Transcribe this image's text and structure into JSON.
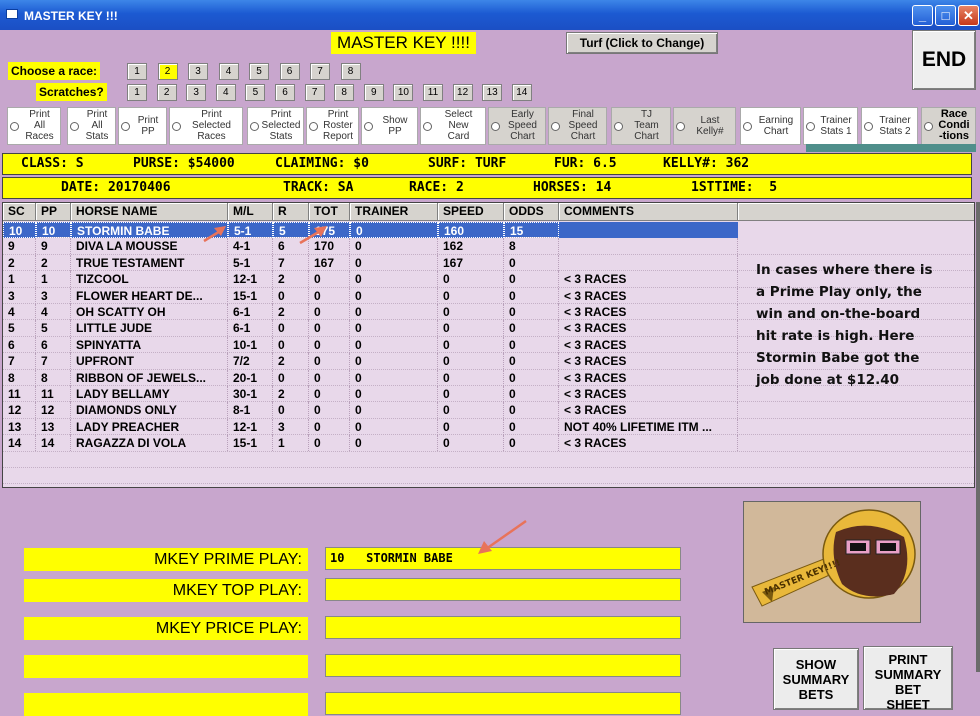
{
  "window": {
    "title": "MASTER KEY !!!"
  },
  "header": {
    "title": "MASTER KEY !!!!",
    "turf_button": "Turf (Click to Change)",
    "end_button": "END"
  },
  "race_chooser": {
    "label": "Choose  a race:",
    "numbers": [
      "1",
      "2",
      "3",
      "4",
      "5",
      "6",
      "7",
      "8"
    ],
    "selected": "2"
  },
  "scratches": {
    "label": "Scratches?",
    "numbers": [
      "1",
      "2",
      "3",
      "4",
      "5",
      "6",
      "7",
      "8",
      "9",
      "10",
      "11",
      "12",
      "13",
      "14"
    ]
  },
  "options": [
    {
      "label": "Print\nAll\nRaces",
      "style": "white"
    },
    {
      "label": "Print\nAll\nStats",
      "style": "white"
    },
    {
      "label": "Print\nPP",
      "style": "white"
    },
    {
      "label": "Print\nSelected\nRaces",
      "style": "white"
    },
    {
      "label": "Print\nSelected\nStats",
      "style": "white"
    },
    {
      "label": "Print\nRoster\nReport",
      "style": "white"
    },
    {
      "label": "Show\nPP",
      "style": "white"
    },
    {
      "label": "Select\nNew\nCard",
      "style": "white"
    },
    {
      "label": "Early\nSpeed\nChart",
      "style": "gray"
    },
    {
      "label": "Final\nSpeed\nChart",
      "style": "gray"
    },
    {
      "label": "TJ\nTeam\nChart",
      "style": "gray"
    },
    {
      "label": "Last\nKelly#",
      "style": "gray"
    },
    {
      "label": "Earning\nChart",
      "style": "white"
    },
    {
      "label": "Trainer\nStats 1",
      "style": "white"
    },
    {
      "label": "Trainer\nStats 2",
      "style": "white"
    },
    {
      "label": "Race\nCondi\n-tions",
      "style": "race"
    }
  ],
  "info1": {
    "class": "CLASS: S",
    "purse": "PURSE: $54000",
    "claiming": "CLAIMING: $0",
    "surf": "SURF: TURF",
    "fur": "FUR: 6.5",
    "kelly": "KELLY#: 362"
  },
  "info2": {
    "date": "DATE: 20170406",
    "track": "TRACK: SA",
    "race": "RACE: 2",
    "horses": "HORSES: 14",
    "first": "1STTIME:  5"
  },
  "table": {
    "columns": [
      "SC",
      "PP",
      "HORSE NAME",
      "M/L",
      "R",
      "TOT",
      "TRAINER",
      "SPEED",
      "ODDS",
      "COMMENTS"
    ],
    "rows": [
      [
        "10",
        "10",
        "STORMIN BABE",
        "5-1",
        "5",
        "175",
        "0",
        "160",
        "15",
        ""
      ],
      [
        "9",
        "9",
        "DIVA LA MOUSSE",
        "4-1",
        "6",
        "170",
        "0",
        "162",
        "8",
        ""
      ],
      [
        "2",
        "2",
        "TRUE TESTAMENT",
        "5-1",
        "7",
        "167",
        "0",
        "167",
        "0",
        ""
      ],
      [
        "1",
        "1",
        "TIZCOOL",
        "12-1",
        "2",
        "0",
        "0",
        "0",
        "0",
        "< 3 RACES"
      ],
      [
        "3",
        "3",
        "FLOWER HEART DE...",
        "15-1",
        "0",
        "0",
        "0",
        "0",
        "0",
        "< 3 RACES"
      ],
      [
        "4",
        "4",
        "OH SCATTY OH",
        "6-1",
        "2",
        "0",
        "0",
        "0",
        "0",
        "< 3 RACES"
      ],
      [
        "5",
        "5",
        "LITTLE JUDE",
        "6-1",
        "0",
        "0",
        "0",
        "0",
        "0",
        "< 3 RACES"
      ],
      [
        "6",
        "6",
        "SPINYATTA",
        "10-1",
        "0",
        "0",
        "0",
        "0",
        "0",
        "< 3 RACES"
      ],
      [
        "7",
        "7",
        "UPFRONT",
        "7/2",
        "2",
        "0",
        "0",
        "0",
        "0",
        "< 3 RACES"
      ],
      [
        "8",
        "8",
        "RIBBON OF JEWELS...",
        "20-1",
        "0",
        "0",
        "0",
        "0",
        "0",
        "< 3 RACES"
      ],
      [
        "11",
        "11",
        "LADY BELLAMY",
        "30-1",
        "2",
        "0",
        "0",
        "0",
        "0",
        "< 3 RACES"
      ],
      [
        "12",
        "12",
        "DIAMONDS ONLY",
        "8-1",
        "0",
        "0",
        "0",
        "0",
        "0",
        "< 3 RACES"
      ],
      [
        "13",
        "13",
        "LADY PREACHER",
        "12-1",
        "3",
        "0",
        "0",
        "0",
        "0",
        "NOT 40% LIFETIME ITM  ..."
      ],
      [
        "14",
        "14",
        "RAGAZZA DI VOLA",
        "15-1",
        "1",
        "0",
        "0",
        "0",
        "0",
        "< 3 RACES"
      ]
    ]
  },
  "annotation": [
    "In cases where there is",
    "a Prime Play only, the",
    "win and on-the-board",
    "hit rate is high.  Here",
    "Stormin Babe got the",
    "job done at $12.40"
  ],
  "plays": [
    {
      "label": "MKEY PRIME PLAY:",
      "value": "10   STORMIN BABE"
    },
    {
      "label": "MKEY TOP PLAY:",
      "value": ""
    },
    {
      "label": "MKEY PRICE PLAY:",
      "value": ""
    },
    {
      "label": "",
      "value": ""
    },
    {
      "label": "",
      "value": ""
    }
  ],
  "key_image_text": "MASTER KEY!!!!",
  "buttons": {
    "show_summary": "SHOW\nSUMMARY\nBETS",
    "print_summary": "PRINT\nSUMMARY\nBET\nSHEET"
  },
  "colors": {
    "background": "#c8a6cd",
    "highlight": "#ffff00",
    "selection": "#3c67c8",
    "arrow": "#e8735a"
  }
}
